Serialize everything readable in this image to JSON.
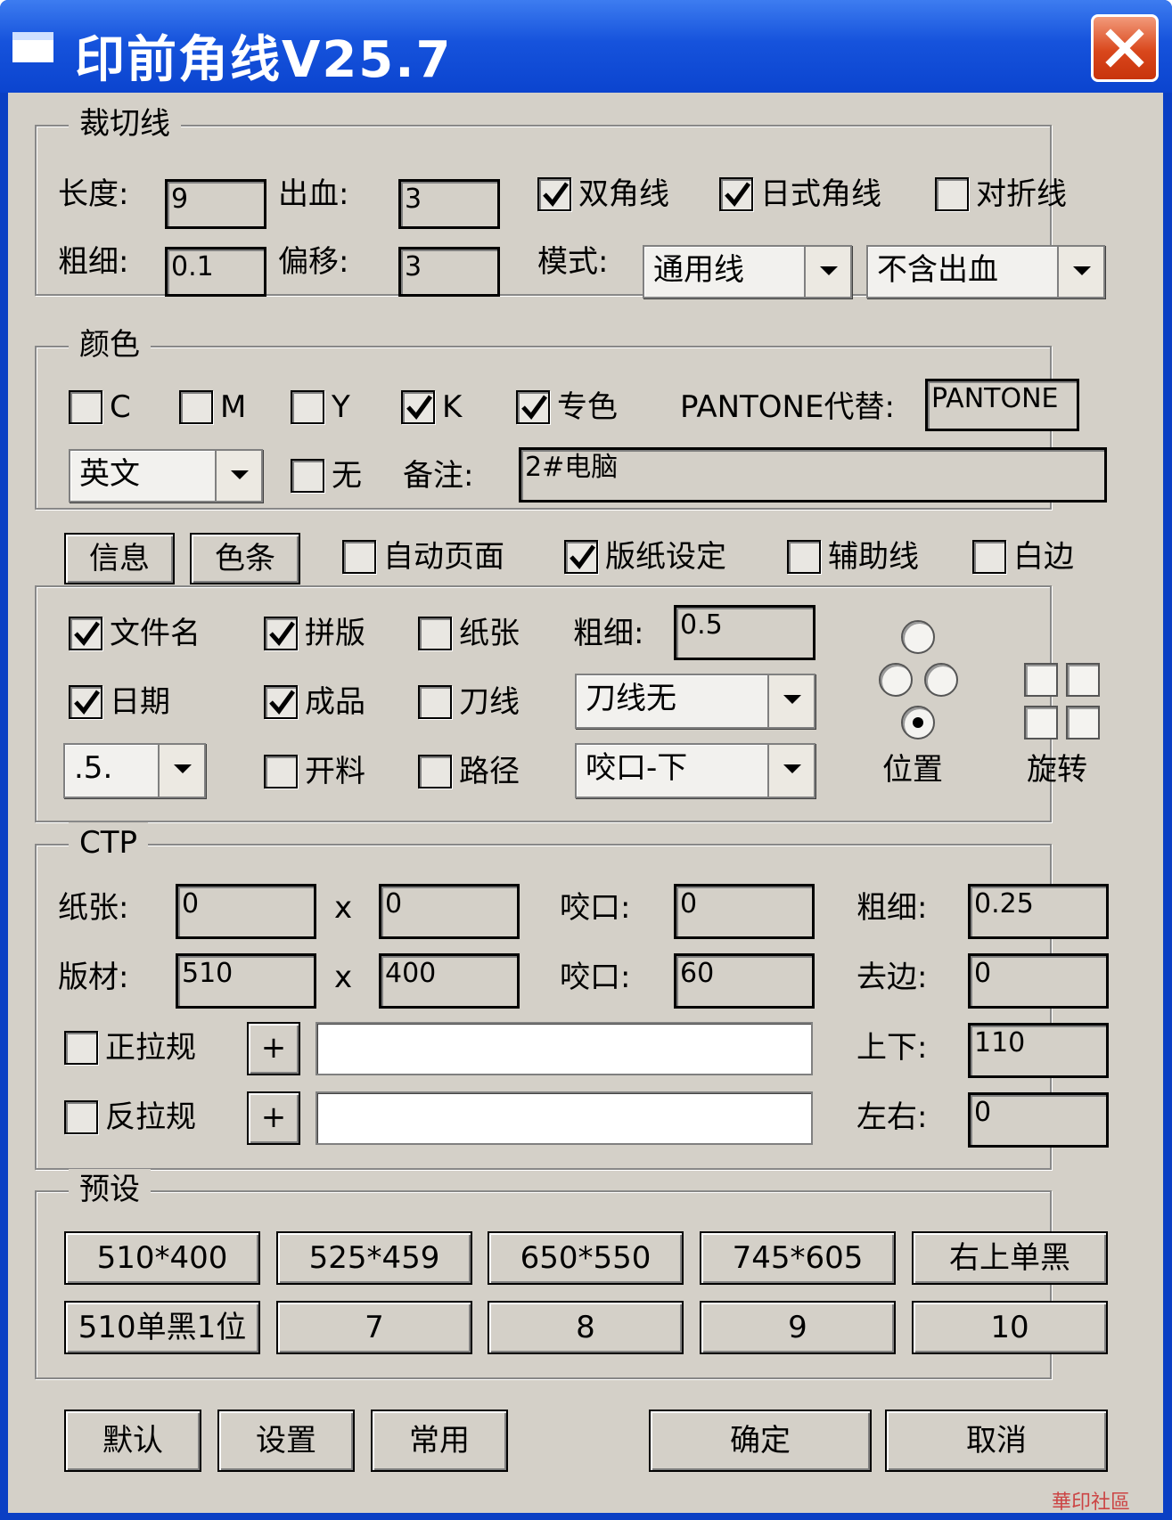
{
  "window": {
    "title": "印前角线V25.7"
  },
  "cut_lines": {
    "legend": "裁切线",
    "length_label": "长度:",
    "length_value": "9",
    "bleed_label": "出血:",
    "bleed_value": "3",
    "double_corner": "双角线",
    "japanese_corner": "日式角线",
    "fold_line": "对折线",
    "thickness_label": "粗细:",
    "thickness_value": "0.1",
    "offset_label": "偏移:",
    "offset_value": "3",
    "mode_label": "模式:",
    "mode_value": "通用线",
    "bleed_mode_value": "不含出血"
  },
  "color": {
    "legend": "颜色",
    "c": "C",
    "m": "M",
    "y": "Y",
    "k": "K",
    "spot": "专色",
    "pantone_label": "PANTONE代替:",
    "pantone_value": "PANTONE",
    "language_value": "英文",
    "none": "无",
    "note_label": "备注:",
    "note_value": "2#电脑"
  },
  "options_bar": {
    "info_button": "信息",
    "colorbar_button": "色条",
    "auto_page": "自动页面",
    "plate_setting": "版纸设定",
    "guide_line": "辅助线",
    "white_edge": "白边"
  },
  "plate": {
    "filename": "文件名",
    "imposition": "拼版",
    "paper": "纸张",
    "thickness_label": "粗细:",
    "thickness_value": "0.5",
    "date": "日期",
    "finished": "成品",
    "knife_line": "刀线",
    "knife_select": "刀线无",
    "font_size_value": ".5.",
    "cutting": "开料",
    "path": "路径",
    "gripper_select": "咬口-下",
    "position_label": "位置",
    "rotate_label": "旋转"
  },
  "ctp": {
    "legend": "CTP",
    "paper_label": "纸张:",
    "paper_w": "0",
    "x1": "x",
    "paper_h": "0",
    "gripper1_label": "咬口:",
    "gripper1_value": "0",
    "thickness_label": "粗细:",
    "thickness_value": "0.25",
    "plate_label": "版材:",
    "plate_w": "510",
    "x2": "x",
    "plate_h": "400",
    "gripper2_label": "咬口:",
    "gripper2_value": "60",
    "trim_label": "去边:",
    "trim_value": "0",
    "front_lay": "正拉规",
    "plus1": "+",
    "updown_label": "上下:",
    "updown_value": "110",
    "back_lay": "反拉规",
    "plus2": "+",
    "leftright_label": "左右:",
    "leftright_value": "0"
  },
  "presets": {
    "legend": "预设",
    "items": [
      "510*400",
      "525*459",
      "650*550",
      "745*605",
      "右上单黑",
      "510单黑1位",
      "7",
      "8",
      "9",
      "10"
    ]
  },
  "footer": {
    "default": "默认",
    "settings": "设置",
    "common": "常用",
    "ok": "确定",
    "cancel": "取消"
  },
  "watermark": "華印社區",
  "colors": {
    "title_bar": "#1653dc",
    "dialog_bg": "#d4d0c8",
    "close": "#d9471c"
  }
}
